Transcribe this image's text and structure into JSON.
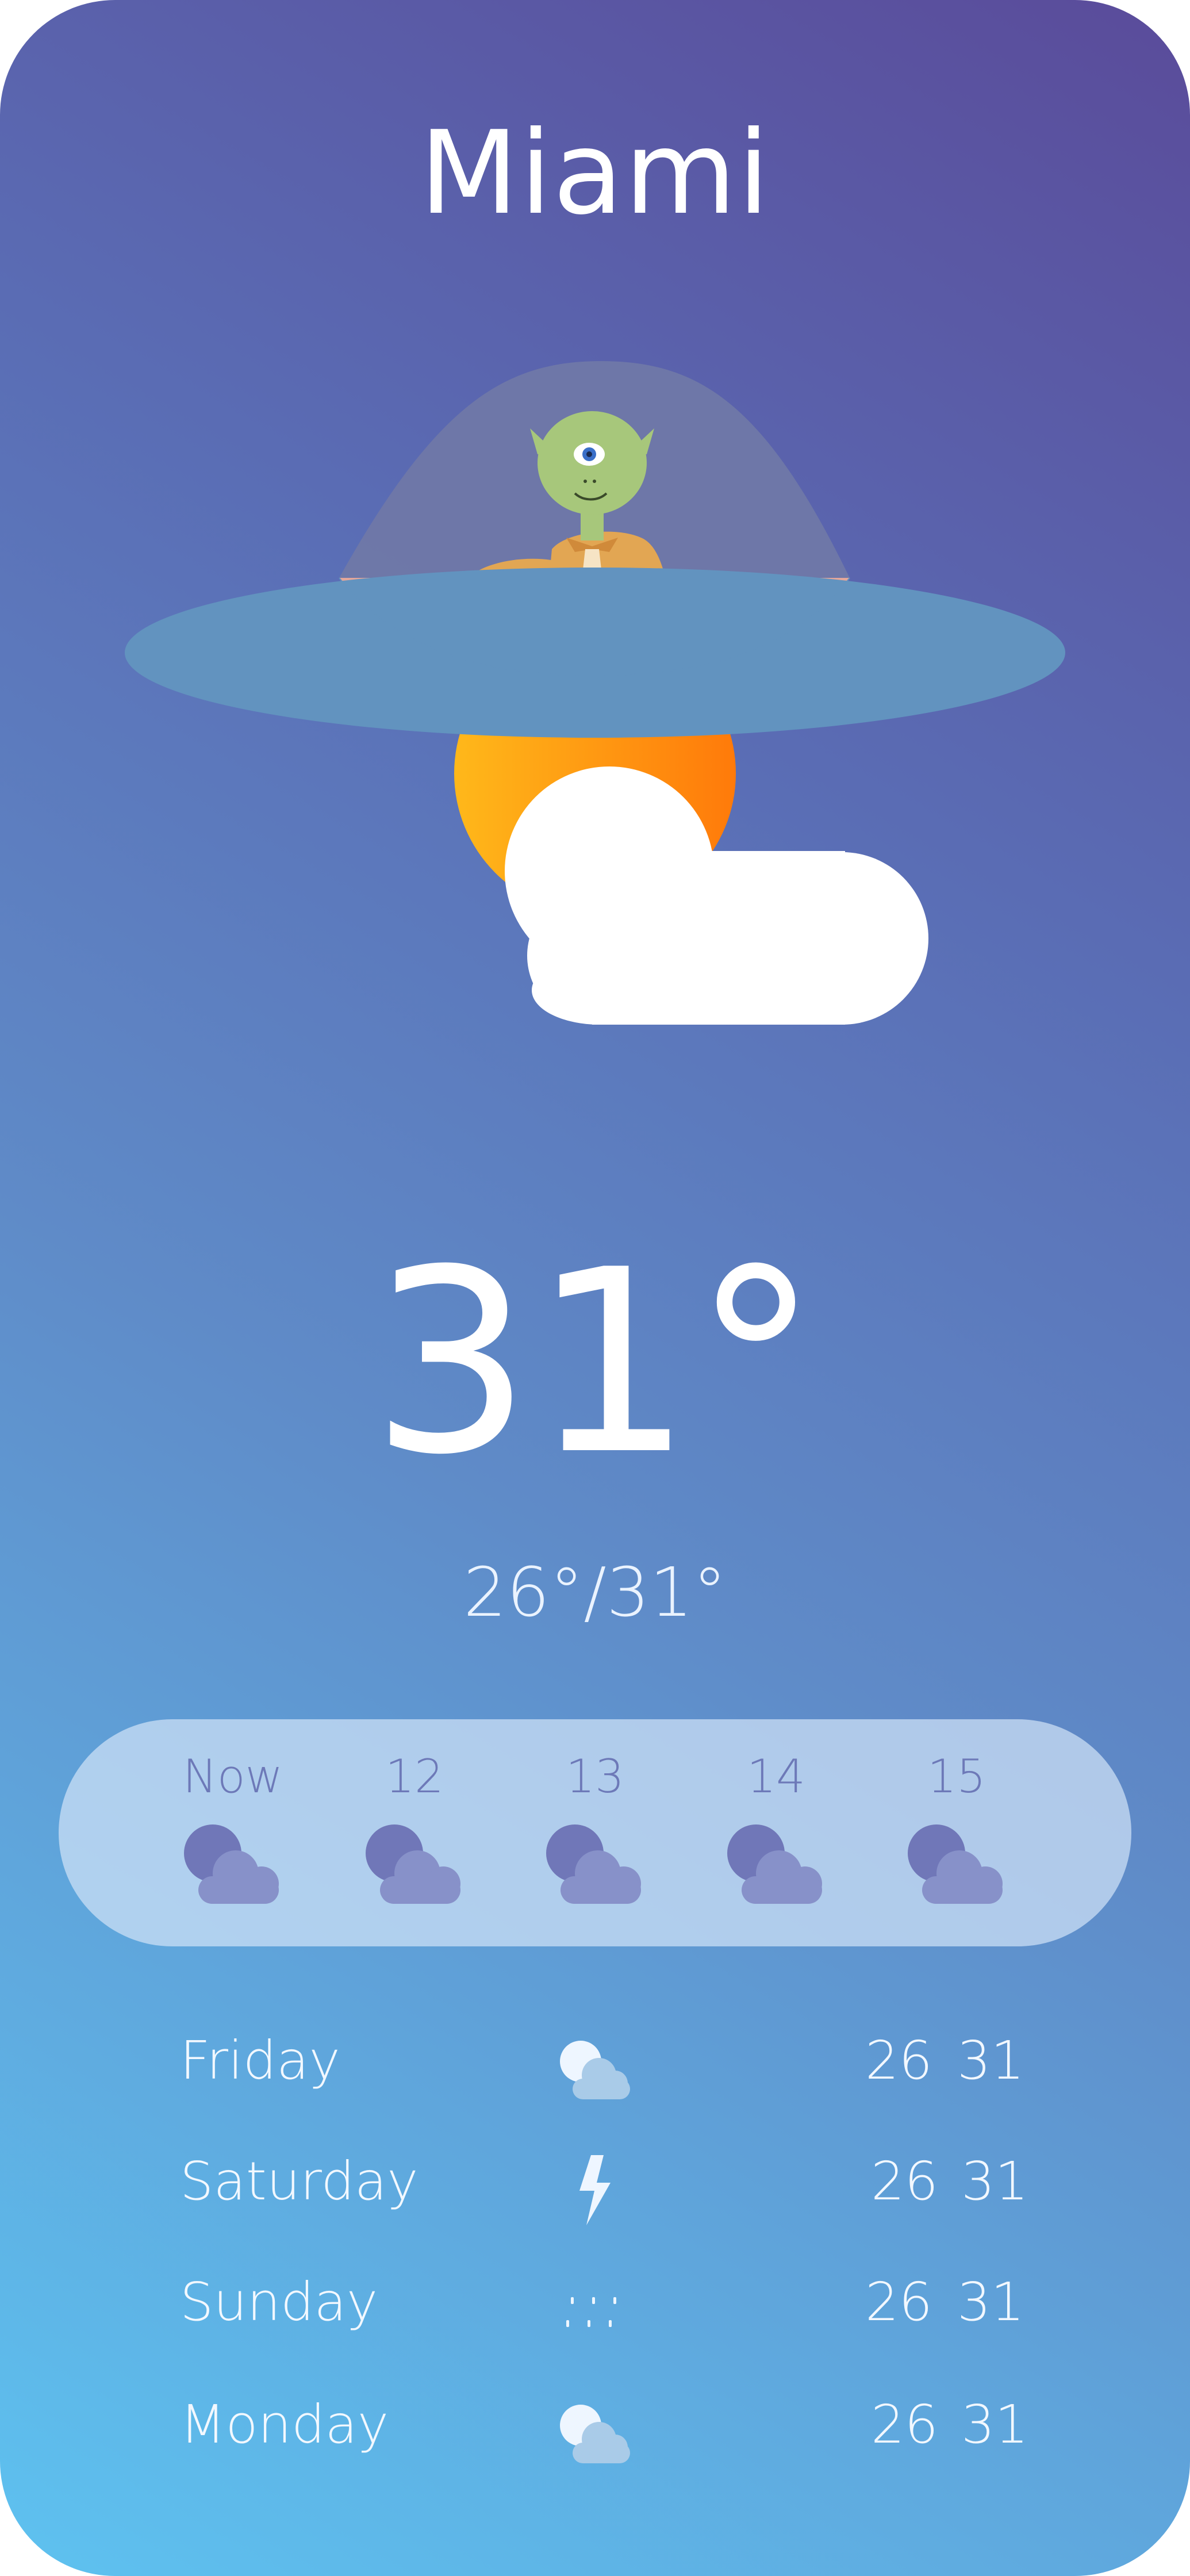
{
  "location": {
    "city": "Miami"
  },
  "current": {
    "temperature": "31°",
    "range": "26°/31°"
  },
  "hourly": [
    {
      "label": "Now",
      "icon": "night-partly-cloudy-icon"
    },
    {
      "label": "12",
      "icon": "night-partly-cloudy-icon"
    },
    {
      "label": "13",
      "icon": "night-partly-cloudy-icon"
    },
    {
      "label": "14",
      "icon": "night-partly-cloudy-icon"
    },
    {
      "label": "15",
      "icon": "night-partly-cloudy-icon"
    }
  ],
  "daily": [
    {
      "day": "Friday",
      "icon": "partly-cloudy-icon",
      "low": "26",
      "high": "31"
    },
    {
      "day": "Saturday",
      "icon": "lightning-icon",
      "low": "26",
      "high": "31"
    },
    {
      "day": "Sunday",
      "icon": "rain-icon",
      "low": "26",
      "high": "31"
    },
    {
      "day": "Monday",
      "icon": "partly-cloudy-icon",
      "low": "26",
      "high": "31"
    }
  ],
  "colors": {
    "gradient_top": "#5a4b9a",
    "gradient_bottom": "#5ec2f0",
    "sun": "#ff9a1a",
    "cloud": "#ffffff",
    "hourly_icon_moon": "#7077b8",
    "hourly_icon_cloud": "#8791c9"
  }
}
